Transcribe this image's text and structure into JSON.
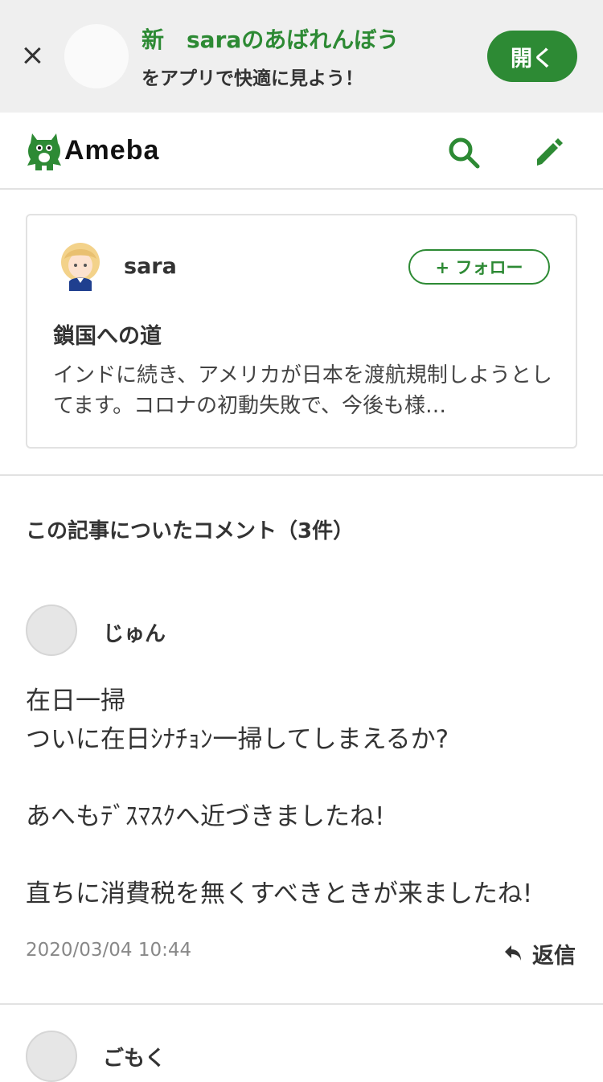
{
  "banner": {
    "title": "新　saraのあばれんぼう",
    "subtitle": "をアプリで快適に見よう！",
    "open_label": "開く"
  },
  "header": {
    "logo_text": "Ameba",
    "search_icon": "search-icon",
    "edit_icon": "pencil-icon"
  },
  "article": {
    "author": "sara",
    "follow_label": "+ フォロー",
    "title": "鎖国への道",
    "excerpt": "インドに続き、アメリカが日本を渡航規制しようとしてます。コロナの初動失敗で、今後も様…"
  },
  "comments_section": {
    "heading": "この記事についたコメント（3件）",
    "items": [
      {
        "name": "じゅん",
        "lines": [
          "在日一掃",
          "ついに在日ｼﾅﾁｮﾝ一掃してしまえるか?",
          "",
          "あへもﾃﾞｽﾏｽｸへ近づきましたね!",
          "",
          "直ちに消費税を無くすべきときが来ましたね!"
        ],
        "date": "2020/03/04 10:44",
        "reply_label": "返信"
      },
      {
        "name": "ごもく"
      }
    ]
  },
  "colors": {
    "accent": "#2d8a34",
    "banner_bg": "#efefef",
    "divider": "#e2e2e2"
  }
}
